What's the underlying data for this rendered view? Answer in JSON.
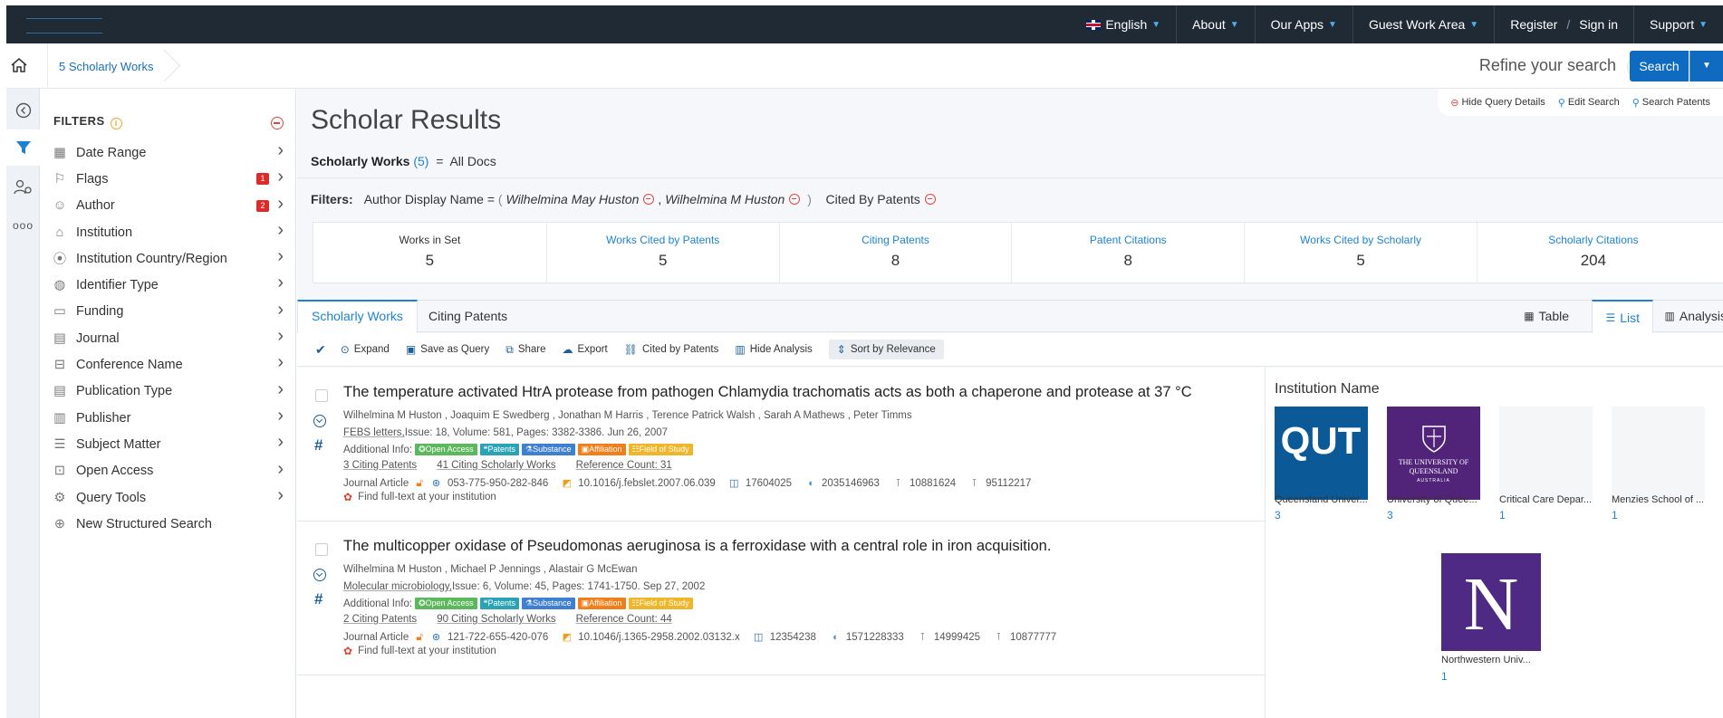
{
  "topnav": {
    "language": "English",
    "about": "About",
    "our_apps": "Our Apps",
    "guest": "Guest Work Area",
    "register": "Register",
    "sep": "/",
    "signin": "Sign in",
    "support": "Support"
  },
  "breadcrumb": {
    "label": "5 Scholarly Works"
  },
  "search": {
    "refine": "Refine your search",
    "help": "?",
    "button": "Search"
  },
  "filters": {
    "title": "FILTERS",
    "items": [
      {
        "label": "Date Range",
        "icon": "calendar-icon",
        "badge": ""
      },
      {
        "label": "Flags",
        "icon": "flag-icon",
        "badge": "1"
      },
      {
        "label": "Author",
        "icon": "user-icon",
        "badge": "2"
      },
      {
        "label": "Institution",
        "icon": "institution-icon",
        "badge": ""
      },
      {
        "label": "Institution Country/Region",
        "icon": "map-pin-icon",
        "badge": ""
      },
      {
        "label": "Identifier Type",
        "icon": "globe-icon",
        "badge": ""
      },
      {
        "label": "Funding",
        "icon": "money-icon",
        "badge": ""
      },
      {
        "label": "Journal",
        "icon": "journal-icon",
        "badge": ""
      },
      {
        "label": "Conference Name",
        "icon": "conference-icon",
        "badge": ""
      },
      {
        "label": "Publication Type",
        "icon": "document-icon",
        "badge": ""
      },
      {
        "label": "Publisher",
        "icon": "books-icon",
        "badge": ""
      },
      {
        "label": "Subject Matter",
        "icon": "list-icon",
        "badge": ""
      },
      {
        "label": "Open Access",
        "icon": "unlock-icon",
        "badge": ""
      },
      {
        "label": "Query Tools",
        "icon": "tools-icon",
        "badge": ""
      },
      {
        "label": "New Structured Search",
        "icon": "search-plus-icon",
        "badge": ""
      }
    ]
  },
  "main": {
    "title": "Scholar Results",
    "query_actions": {
      "hide": "Hide Query Details",
      "edit": "Edit Search",
      "patents": "Search Patents"
    },
    "query": {
      "label": "Scholarly Works",
      "count": "(5)",
      "eq": "=",
      "value": "All Docs"
    },
    "filter_line": {
      "label": "Filters:",
      "field": "Author Display Name =",
      "open": "(",
      "v1": "Wilhelmina May Huston",
      "comma": ",",
      "v2": "Wilhelmina M Huston",
      "close": ")",
      "cited": "Cited By Patents"
    },
    "stats": [
      {
        "label": "Works in Set",
        "value": "5"
      },
      {
        "label": "Works Cited by Patents",
        "value": "5"
      },
      {
        "label": "Citing Patents",
        "value": "8"
      },
      {
        "label": "Patent Citations",
        "value": "8"
      },
      {
        "label": "Works Cited by Scholarly",
        "value": "5"
      },
      {
        "label": "Scholarly Citations",
        "value": "204"
      }
    ],
    "tabs": {
      "scholarly": "Scholarly Works",
      "citing": "Citing Patents"
    },
    "views": {
      "table": "Table",
      "list": "List",
      "analysis": "Analysis"
    },
    "toolbar": {
      "expand": "Expand",
      "save": "Save as Query",
      "share": "Share",
      "export": "Export",
      "cited": "Cited by Patents",
      "hide": "Hide Analysis",
      "sort": "Sort by Relevance"
    }
  },
  "results": [
    {
      "title": "The temperature activated HtrA protease from pathogen Chlamydia trachomatis acts as both a chaperone and protease at 37 °C",
      "authors": "Wilhelmina M Huston , Joaquim E Swedberg , Jonathan M Harris , Terence Patrick Walsh , Sarah A Mathews , Peter Timms",
      "journal": "FEBS letters,",
      "details": " Issue: 18,  Volume: 581,  Pages: 3382-3386.  Jun 26, 2007",
      "additional_label": "Additional Info:",
      "chips": [
        "Open Access",
        "Patents",
        "Substance",
        "Affiliation",
        "Field of Study"
      ],
      "citing_patents": "3 Citing Patents",
      "citing_scholarly": "41 Citing Scholarly Works",
      "ref_count": "Reference Count: 31",
      "type": "Journal Article",
      "lens": "053-775-950-282-846",
      "doi": "10.1016/j.febslet.2007.06.039",
      "pmid": "17604025",
      "mag": "2035146963",
      "id3": "10881624",
      "id4": "95112217",
      "fulltext": "Find full-text at your institution"
    },
    {
      "title": "The multicopper oxidase of Pseudomonas aeruginosa is a ferroxidase with a central role in iron acquisition.",
      "authors": "Wilhelmina M Huston , Michael P Jennings , Alastair G McEwan",
      "journal": "Molecular microbiology,",
      "details": " Issue: 6,  Volume: 45,  Pages: 1741-1750.  Sep 27, 2002",
      "additional_label": "Additional Info:",
      "chips": [
        "Open Access",
        "Patents",
        "Substance",
        "Affiliation",
        "Field of Study"
      ],
      "citing_patents": "2 Citing Patents",
      "citing_scholarly": "90 Citing Scholarly Works",
      "ref_count": "Reference Count: 44",
      "type": "Journal Article",
      "lens": "121-722-655-420-076",
      "doi": "10.1046/j.1365-2958.2002.03132.x",
      "pmid": "12354238",
      "mag": "1571228333",
      "id3": "14999425",
      "id4": "10877777",
      "fulltext": "Find full-text at your institution"
    }
  ],
  "institutions": {
    "title": "Institution Name",
    "items": [
      {
        "name": "Queensland Univer...",
        "count": "3",
        "logo_text": "QUT"
      },
      {
        "name": "University of Quee...",
        "count": "3",
        "logo_text": "THE UNIVERSITY OF QUEENSLAND",
        "logo_sub": "AUSTRALIA"
      },
      {
        "name": "Critical Care Depar...",
        "count": "1"
      },
      {
        "name": "Menzies School of ...",
        "count": "1"
      },
      {
        "name": "Northwestern Univ...",
        "count": "1",
        "logo_text": "N"
      }
    ]
  },
  "colors": {
    "nav_bg": "#1f2a35",
    "accent": "#1d83d0",
    "qut_blue": "#0b5a97",
    "uq_purple": "#51247a",
    "nw_purple": "#4e2a84"
  }
}
